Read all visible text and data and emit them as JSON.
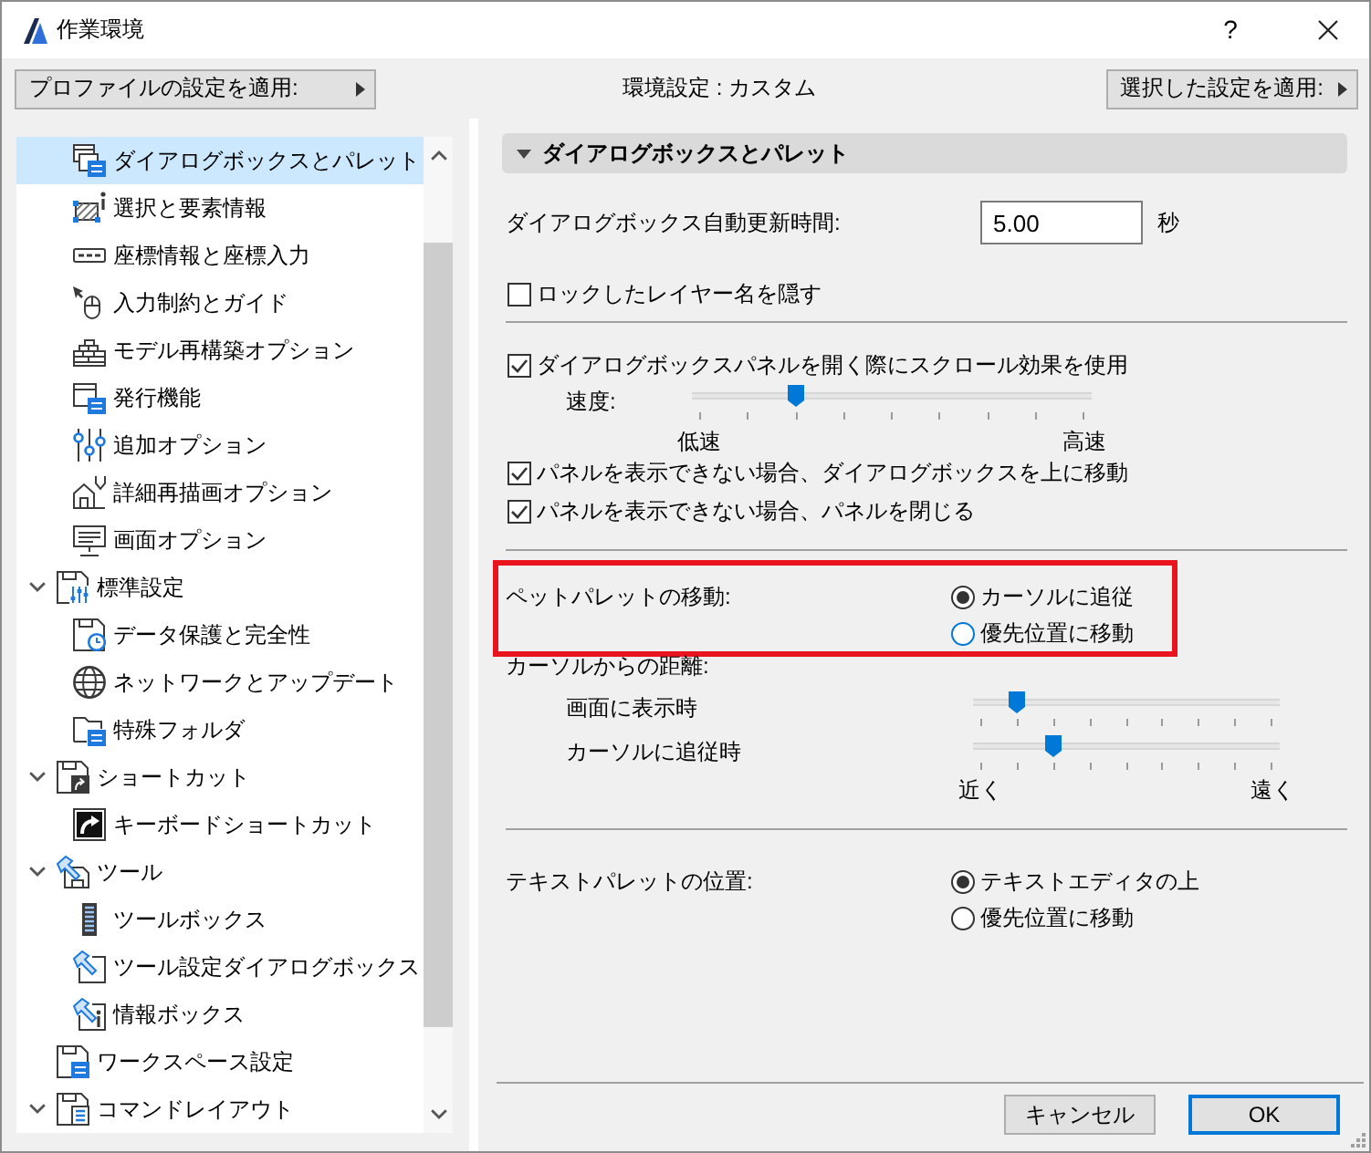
{
  "window": {
    "title": "作業環境",
    "help": "?"
  },
  "toolbar": {
    "profile_button": "プロファイルの設定を適用:",
    "status": "環境設定 : カスタム",
    "apply_button": "選択した設定を適用:"
  },
  "sidebar": {
    "items": [
      {
        "children": [
          {
            "label": "ダイアログボックスとパレット",
            "selected": true
          },
          {
            "label": "選択と要素情報",
            "selected": false
          },
          {
            "label": "座標情報と座標入力",
            "selected": false
          },
          {
            "label": "入力制約とガイド",
            "selected": false
          },
          {
            "label": "モデル再構築オプション",
            "selected": false
          },
          {
            "label": "発行機能",
            "selected": false
          },
          {
            "label": "追加オプション",
            "selected": false
          },
          {
            "label": "詳細再描画オプション",
            "selected": false
          },
          {
            "label": "画面オプション",
            "selected": false
          }
        ]
      },
      {
        "label": "標準設定",
        "selected": false,
        "expanded": true,
        "children": [
          {
            "label": "データ保護と完全性",
            "selected": false
          },
          {
            "label": "ネットワークとアップデート",
            "selected": false
          },
          {
            "label": "特殊フォルダ",
            "selected": false
          }
        ]
      },
      {
        "label": "ショートカット",
        "selected": false,
        "expanded": true,
        "children": [
          {
            "label": "キーボードショートカット",
            "selected": false
          }
        ]
      },
      {
        "label": "ツール",
        "selected": false,
        "expanded": true,
        "children": [
          {
            "label": "ツールボックス",
            "selected": false
          },
          {
            "label": "ツール設定ダイアログボックス",
            "selected": false
          },
          {
            "label": "情報ボックス",
            "selected": false
          }
        ]
      },
      {
        "label": "ワークスペース設定",
        "selected": false
      },
      {
        "label": "コマンドレイアウト",
        "selected": false,
        "expanded": true
      }
    ]
  },
  "panel": {
    "title": "ダイアログボックスとパレット",
    "expanded": true,
    "groups": [
      {
        "items": [
          {
            "kind": "field",
            "label": "ダイアログボックス自動更新時間:",
            "value": "5.00",
            "unit": "秒"
          },
          {
            "kind": "checkbox",
            "label": "ロックしたレイヤー名を隠す",
            "checked": false
          }
        ]
      },
      {
        "items": [
          {
            "kind": "checkbox",
            "label": "ダイアログボックスパネルを開く際にスクロール効果を使用",
            "checked": true
          },
          {
            "kind": "slider",
            "label": "速度:",
            "level": 0.25,
            "min_label": "低速",
            "max_label": "高速"
          },
          {
            "kind": "checkbox",
            "label": "パネルを表示できない場合、ダイアログボックスを上に移動",
            "checked": true
          },
          {
            "kind": "checkbox",
            "label": "パネルを表示できない場合、パネルを閉じる",
            "checked": true
          }
        ]
      },
      {
        "items": [
          {
            "kind": "radio",
            "label": "ペットパレットの移動:",
            "highlighted": true,
            "options": [
              {
                "label": "カーソルに追従",
                "selected": true,
                "hovered": false
              },
              {
                "label": "優先位置に移動",
                "selected": false,
                "hovered": true
              }
            ]
          },
          {
            "kind": "sliders",
            "label": "カーソルからの距離:",
            "sliders": [
              {
                "label": "画面に表示時",
                "level": 0.125
              },
              {
                "label": "カーソルに追従時",
                "level": 0.25
              }
            ],
            "min_label": "近く",
            "max_label": "遠く"
          }
        ]
      },
      {
        "items": [
          {
            "kind": "radio",
            "label": "テキストパレットの位置:",
            "highlighted": false,
            "options": [
              {
                "label": "テキストエディタの上",
                "selected": true,
                "hovered": false
              },
              {
                "label": "優先位置に移動",
                "selected": false,
                "hovered": false
              }
            ]
          }
        ]
      }
    ]
  },
  "buttons": [
    {
      "label": "キャンセル",
      "default": false
    },
    {
      "label": "OK",
      "default": true
    }
  ]
}
